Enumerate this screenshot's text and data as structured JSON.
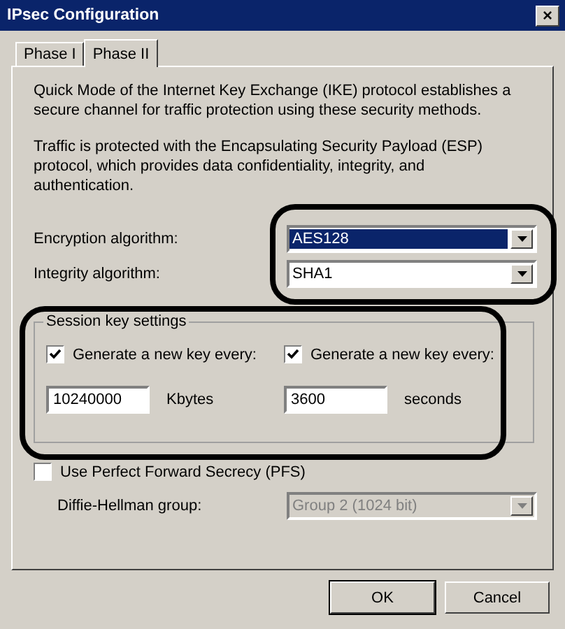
{
  "window": {
    "title": "IPsec Configuration",
    "close": "×"
  },
  "tabs": [
    {
      "label": "Phase I",
      "selected": false
    },
    {
      "label": "Phase II",
      "selected": true
    }
  ],
  "intro": "Quick Mode of the Internet Key Exchange (IKE) protocol establishes a secure channel for traffic protection using these security methods.",
  "esp_note": "Traffic is protected with the Encapsulating Security Payload (ESP) protocol, which provides data confidentiality, integrity, and authentication.",
  "algorithms": [
    {
      "label": "Encryption algorithm:",
      "value": "AES128",
      "selected": true
    },
    {
      "label": "Integrity algorithm:",
      "value": "SHA1",
      "selected": false
    }
  ],
  "session_keys": {
    "title": "Session key settings",
    "rules": [
      {
        "label": "Generate a new key every:",
        "checked": true,
        "value": "10240000",
        "unit": "Kbytes"
      },
      {
        "label": "Generate a new key every:",
        "checked": true,
        "value": "3600",
        "unit": "seconds"
      }
    ]
  },
  "pfs": {
    "label": "Use Perfect Forward Secrecy (PFS)",
    "checked": false
  },
  "dh_group": {
    "label": "Diffie-Hellman group:",
    "value": "Group 2 (1024 bit)",
    "disabled": true
  },
  "buttons": [
    {
      "label": "OK",
      "default": true
    },
    {
      "label": "Cancel",
      "default": false
    }
  ]
}
